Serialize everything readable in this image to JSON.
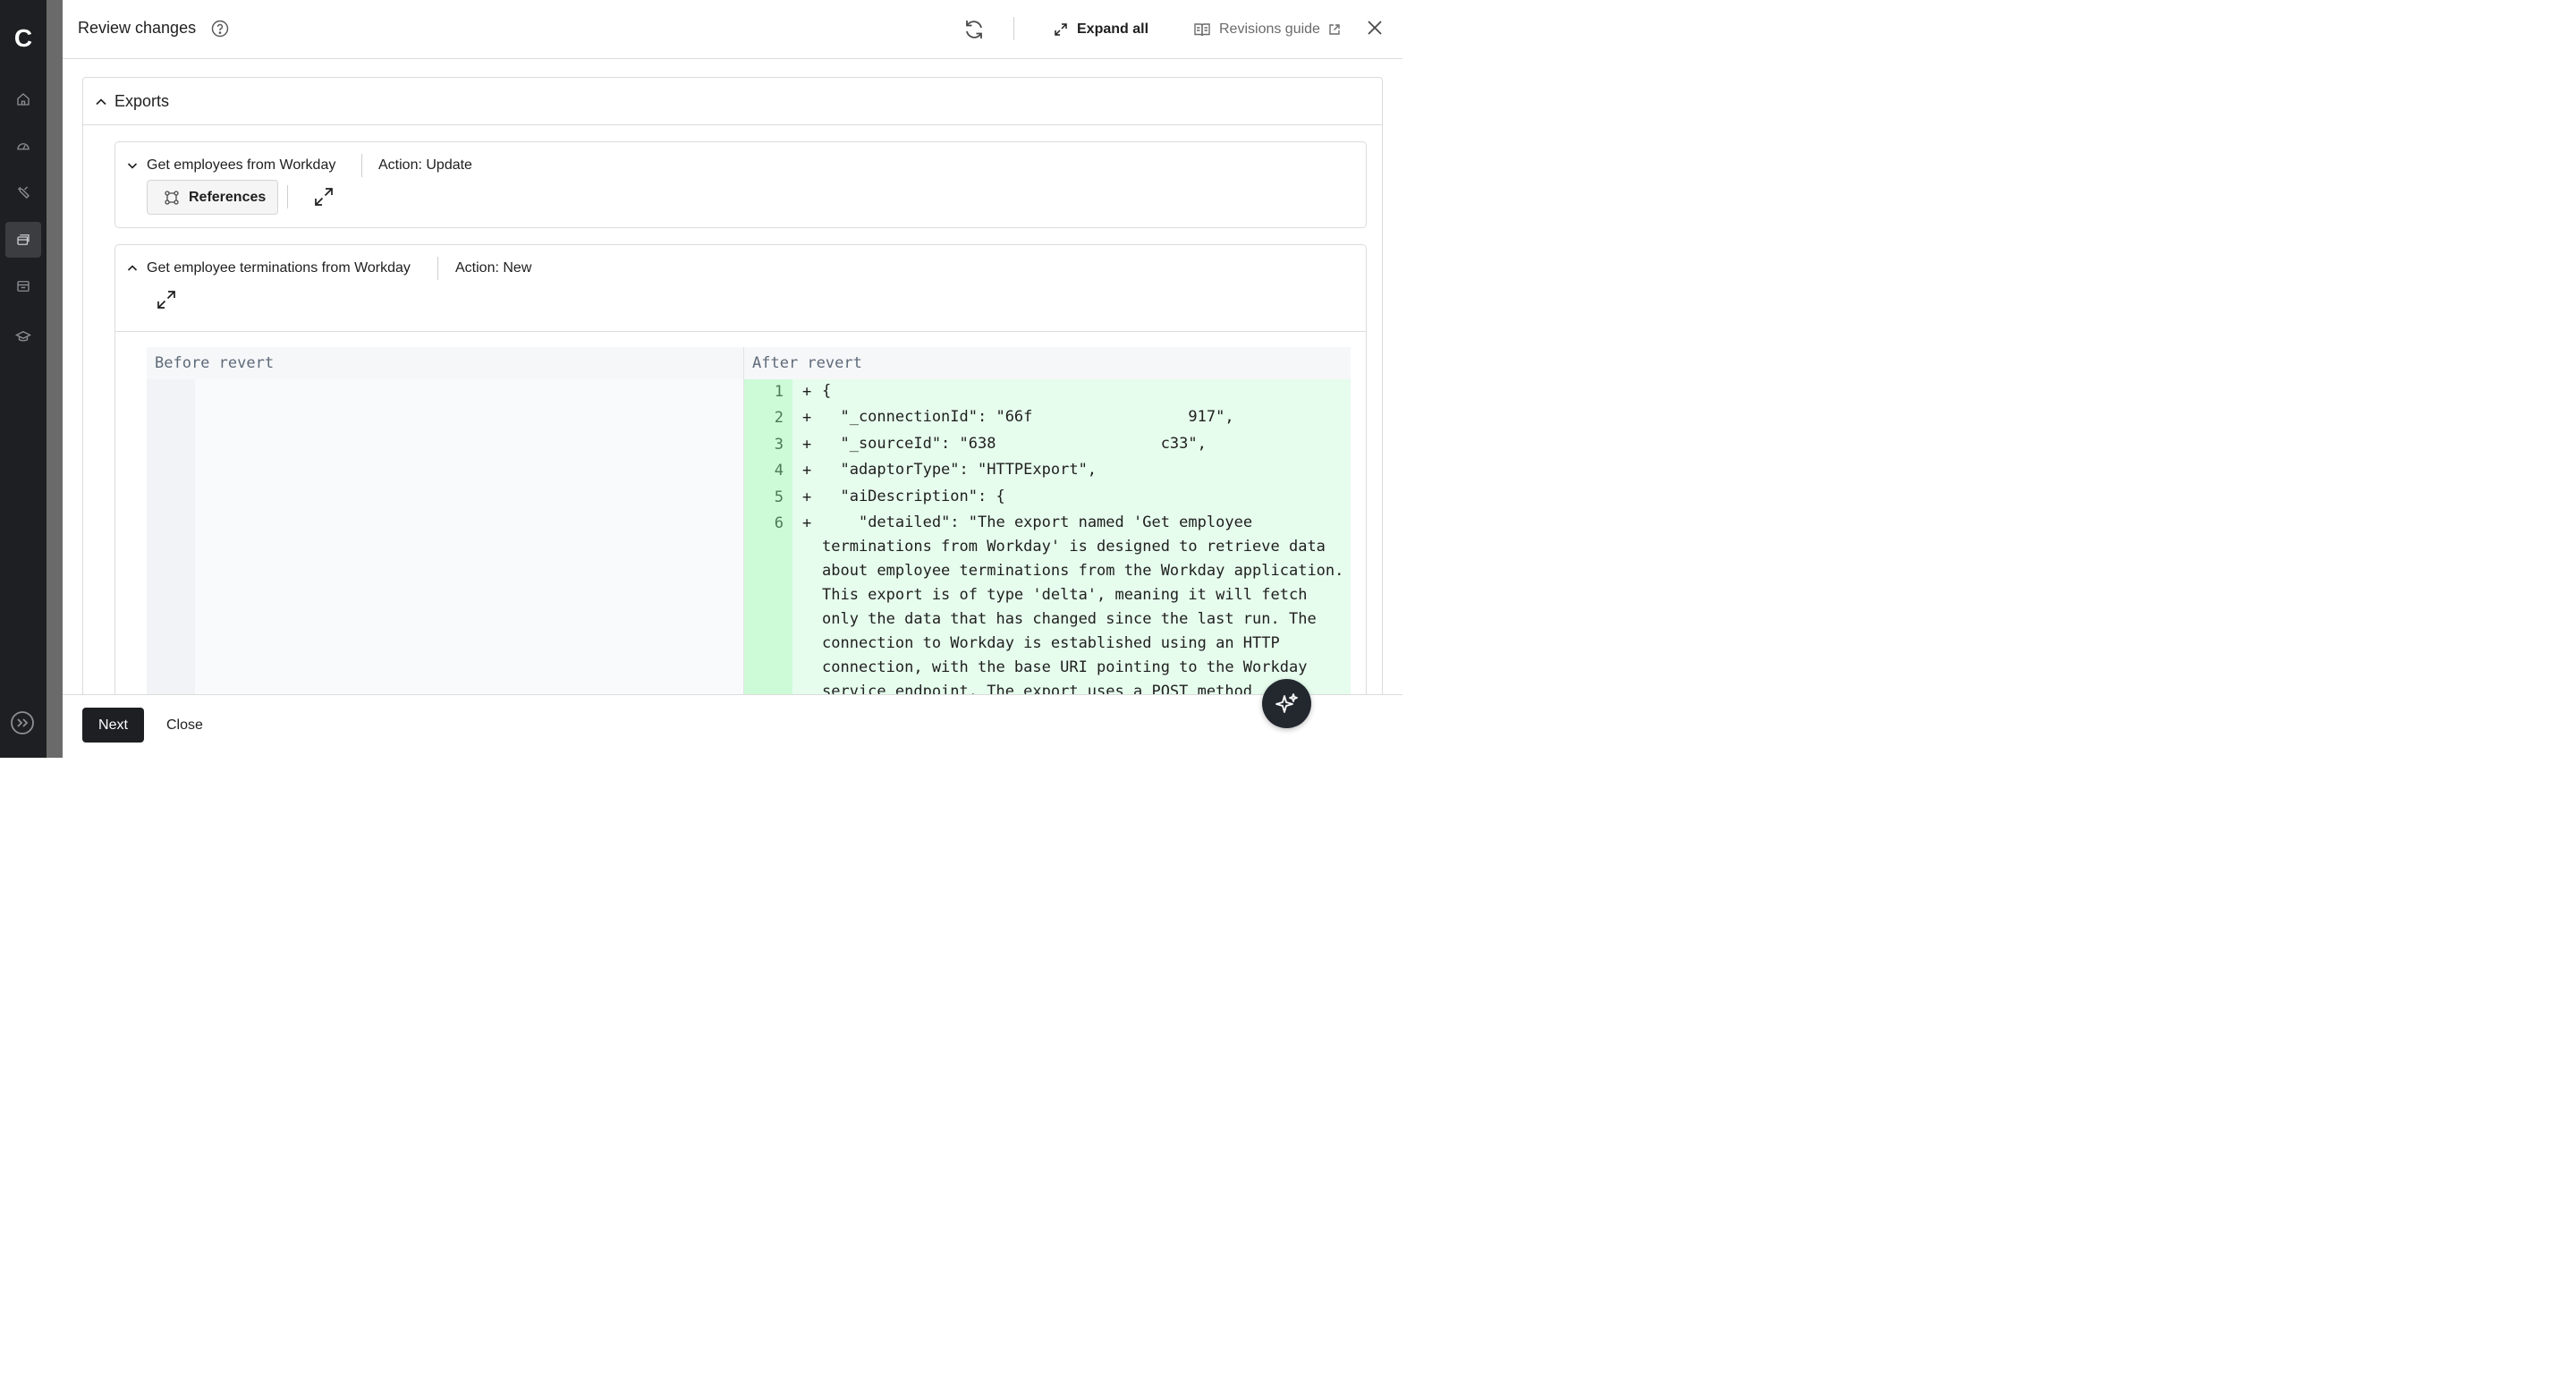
{
  "app": {
    "logo_letter": "C",
    "nav_icons": [
      "home-icon",
      "dashboard-icon",
      "tools-icon",
      "integrations-icon",
      "marketplace-icon",
      "learning-icon"
    ],
    "active_nav": "integrations-icon"
  },
  "drawer": {
    "title": "Review changes",
    "expand_all_label": "Expand all",
    "revisions_guide_label": "Revisions guide"
  },
  "section": {
    "title": "Exports",
    "items": [
      {
        "name": "Get employees from Workday",
        "action": "Action: Update",
        "references_label": "References"
      },
      {
        "name": "Get employee terminations from Workday",
        "action": "Action: New"
      }
    ]
  },
  "diff": {
    "before_label": "Before revert",
    "after_label": "After revert",
    "lines": [
      {
        "no": "1",
        "sign": "+",
        "text": "{"
      },
      {
        "no": "2",
        "sign": "+",
        "text": "  \"_connectionId\": \"66f                 917\","
      },
      {
        "no": "3",
        "sign": "+",
        "text": "  \"_sourceId\": \"638                  c33\","
      },
      {
        "no": "4",
        "sign": "+",
        "text": "  \"adaptorType\": \"HTTPExport\","
      },
      {
        "no": "5",
        "sign": "+",
        "text": "  \"aiDescription\": {"
      },
      {
        "no": "6",
        "sign": "+",
        "text": "    \"detailed\": \"The export named 'Get employee terminations from Workday' is designed to retrieve data about employee terminations from the Workday application. This export is of type 'delta', meaning it will fetch only the data that has changed since the last run. The connection to Workday is established using an HTTP connection, with the base URI pointing to the Workday service endpoint. The export uses a POST method"
      }
    ]
  },
  "footer": {
    "next_label": "Next",
    "close_label": "Close"
  },
  "colors": {
    "sidebar_bg": "#1e1f22",
    "added_line_bg": "#e6fced",
    "added_gutter_bg": "#cdfbd7",
    "primary_button": "#1e1f22"
  }
}
